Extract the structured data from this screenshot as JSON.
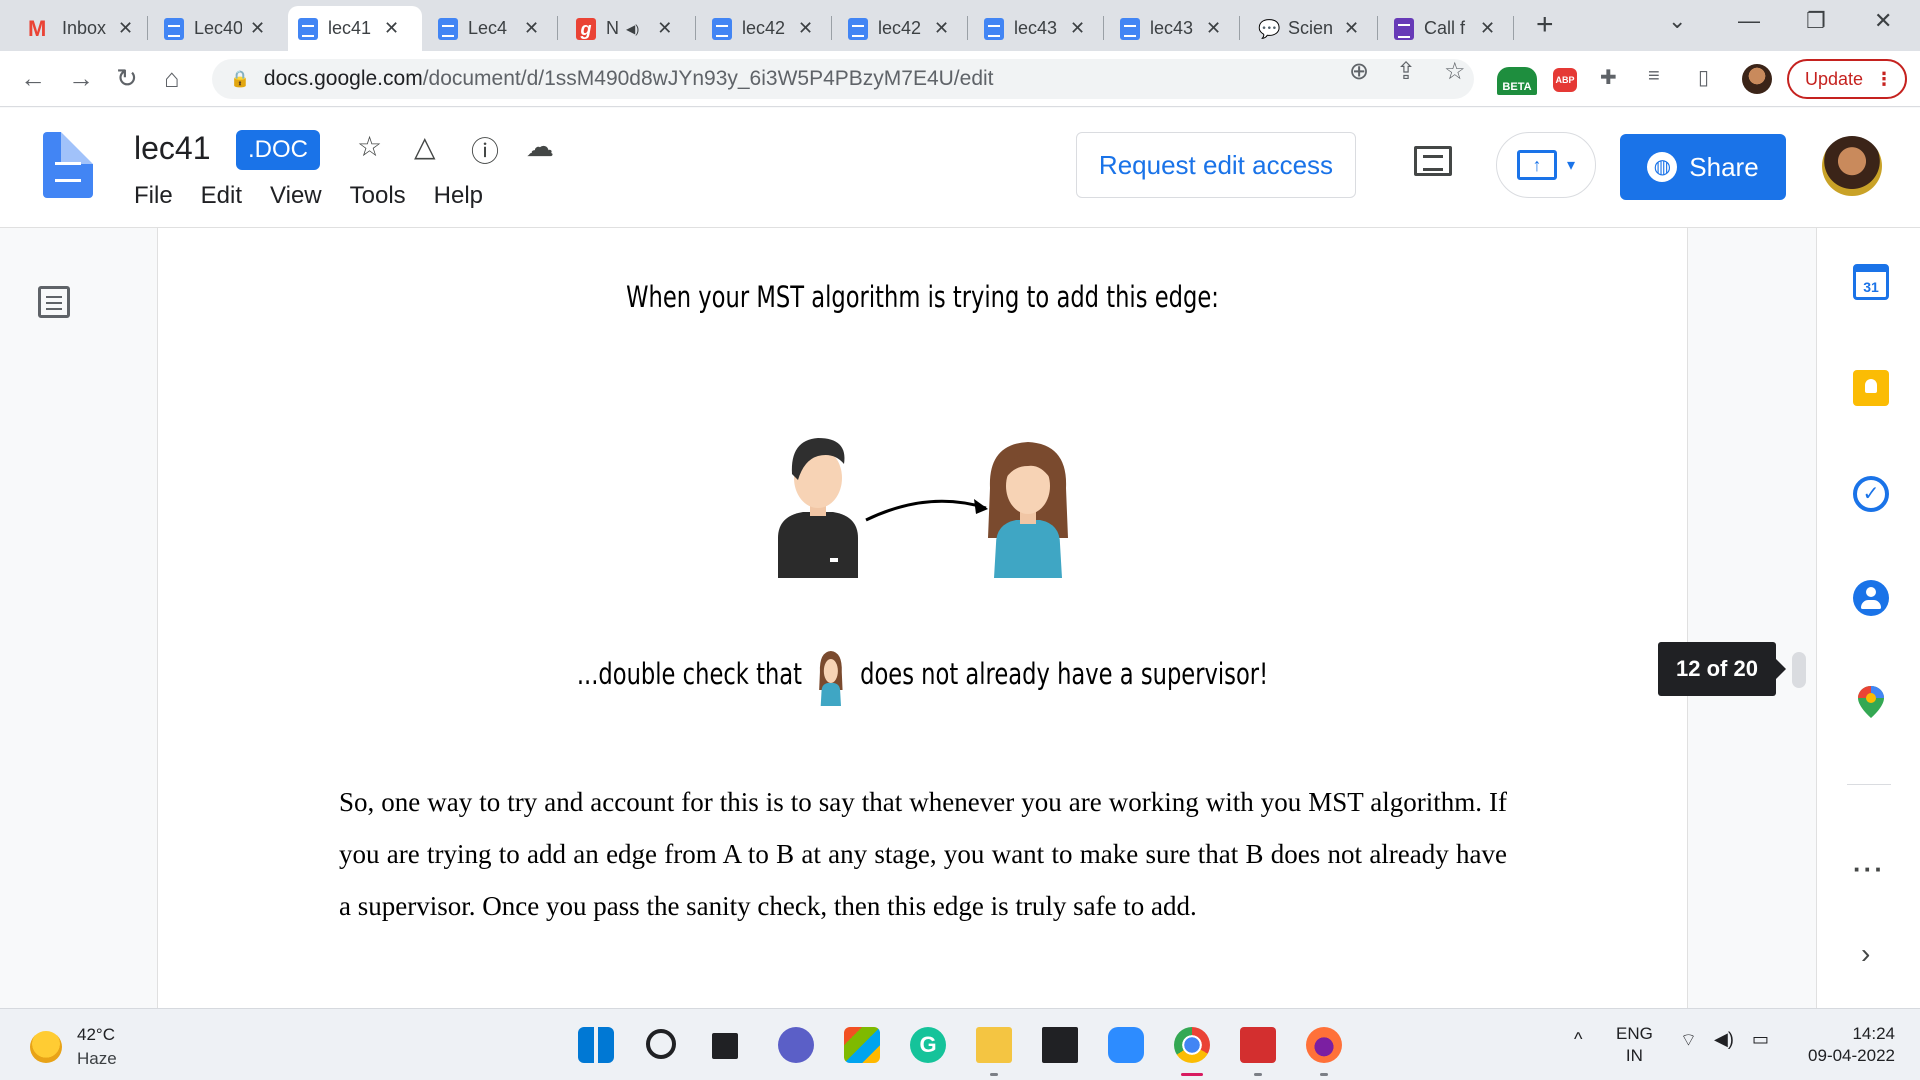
{
  "browser": {
    "tabs": [
      {
        "label": "Inbox",
        "icon": "gmail-icon"
      },
      {
        "label": "Lec40",
        "icon": "docs-icon"
      },
      {
        "label": "lec41",
        "icon": "docs-icon",
        "active": true
      },
      {
        "label": "Lec4",
        "icon": "docs-icon"
      },
      {
        "label": "N",
        "icon": "red-g-icon",
        "muted": true
      },
      {
        "label": "lec42",
        "icon": "docs-icon"
      },
      {
        "label": "lec42",
        "icon": "docs-icon"
      },
      {
        "label": "lec43",
        "icon": "docs-icon"
      },
      {
        "label": "lec43",
        "icon": "docs-icon"
      },
      {
        "label": "Scien",
        "icon": "chat-bubble-icon"
      },
      {
        "label": "Call f",
        "icon": "forms-icon"
      }
    ],
    "close_glyph": "✕",
    "url_host": "docs.google.com",
    "url_path": "/document/d/1ssM490d8wJYn93y_6i3W5P4PBzyM7E4U/edit",
    "beta_label": "BETA",
    "abp_label": "ABP",
    "update_label": "Update"
  },
  "docs": {
    "title": "lec41",
    "badge": ".DOC",
    "menu": [
      "File",
      "Edit",
      "View",
      "Tools",
      "Help"
    ],
    "request_edit_label": "Request edit access",
    "share_label": "Share"
  },
  "document": {
    "figure_caption_1": "When your MST algorithm is trying to add this edge:",
    "figure_caption_2a": "...double check that",
    "figure_caption_2b": "does not already have a supervisor!",
    "paragraph": "So, one way to try and account for this is to say that whenever you are working with you MST algorithm. If you are trying to add an edge from A to B at any stage, you want to make sure that B does not already have a supervisor. Once you pass the sanity check, then this edge is truly safe to add."
  },
  "scroll": {
    "page_indicator": "12 of 20"
  },
  "sidepanel": {
    "calendar_day": "31"
  },
  "taskbar": {
    "temperature": "42°C",
    "condition": "Haze",
    "lang_1": "ENG",
    "lang_2": "IN",
    "time": "14:24",
    "date": "09-04-2022"
  },
  "colors": {
    "accent": "#1a73e8",
    "update_red": "#c5221f",
    "chrome_active_indicator": "#d81b60"
  }
}
